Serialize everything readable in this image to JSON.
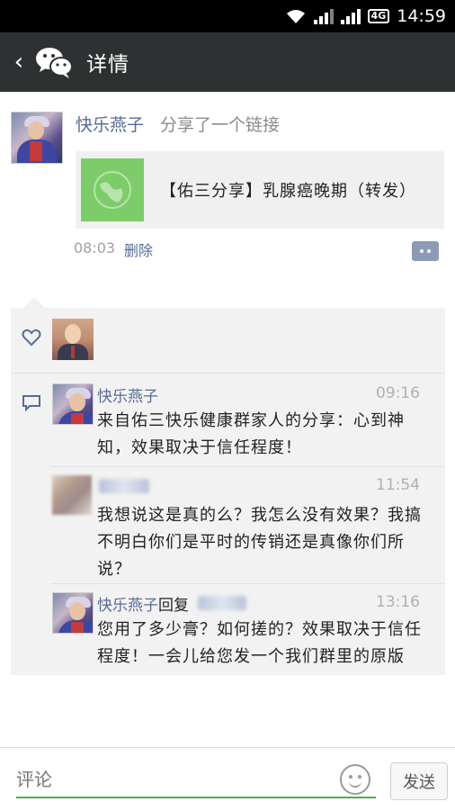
{
  "status_bar": {
    "network_badge": "4G",
    "time": "14:59"
  },
  "header": {
    "back_icon": "chevron-left-icon",
    "title": "详情"
  },
  "post": {
    "author": "快乐燕子",
    "action": "分享了一个链接",
    "link_title": "【佑三分享】乳腺癌晚期（转发）",
    "time": "08:03",
    "delete_label": "删除"
  },
  "comments": [
    {
      "author": "快乐燕子",
      "time": "09:16",
      "text": "来自佑三快乐健康群家人的分享：心到神知，效果取决于信任程度！"
    },
    {
      "author": "",
      "time": "11:54",
      "text": "我想说这是真的么？我怎么没有效果？我搞不明白你们是平时的传销还是真像你们所说？"
    },
    {
      "author": "快乐燕子",
      "reply_label": "回复",
      "time": "13:16",
      "text": "您用了多少膏？如何搓的？效果取决于信任程度！一会儿给您发一个我们群里的原版"
    }
  ],
  "footer": {
    "comment_placeholder": "评论",
    "send_label": "发送"
  }
}
